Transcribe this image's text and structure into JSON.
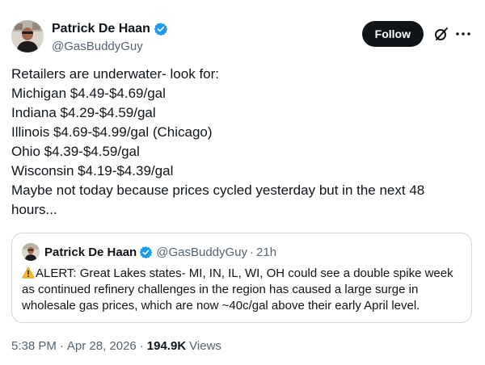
{
  "author": {
    "display_name": "Patrick De Haan",
    "handle": "@GasBuddyGuy",
    "verified_color": "#1d9bf0"
  },
  "actions": {
    "follow_label": "Follow",
    "grok_icon": "grok-icon",
    "more_icon": "more-icon"
  },
  "tweet": {
    "lines": [
      "Retailers are underwater- look for:",
      "Michigan $4.49-$4.69/gal",
      "Indiana $4.29-$4.59/gal",
      "Illinois $4.69-$4.99/gal (Chicago)",
      "Ohio $4.39-$4.59/gal",
      "Wisconsin $4.19-$4.39/gal",
      "Maybe not today because prices cycled yesterday but in the next 48",
      "hours..."
    ]
  },
  "quote": {
    "display_name": "Patrick De Haan",
    "handle": "@GasBuddyGuy",
    "separator": "·",
    "time": "21h",
    "warning_icon": "warning-icon",
    "text": "ALERT: Great Lakes states- MI, IN, IL, WI, OH could see a double spike week as continued refinery challenges in the region has caused a large surge in wholesale gas prices, which are now ~40c/gal above their early April level."
  },
  "meta": {
    "time": "5:38 PM",
    "separator": "·",
    "date": "Apr 28, 2026",
    "views_count": "194.9K",
    "views_label": "Views"
  }
}
